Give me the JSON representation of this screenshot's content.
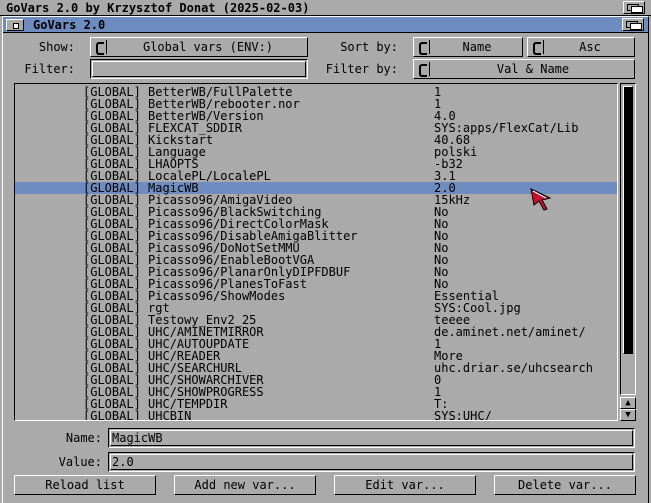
{
  "screen": {
    "title": "GoVars 2.0 by Krzysztof Donat (2025-02-03)"
  },
  "window": {
    "title": "GoVars 2.0"
  },
  "toolbar": {
    "show_label": "Show:",
    "show_value": "Global vars (ENV:)",
    "sortby_label": "Sort by:",
    "sort_field": "Name",
    "sort_order": "Asc",
    "filter_label": "Filter:",
    "filter_value": "",
    "filterby_label": "Filter by:",
    "filterby_value": "Val & Name"
  },
  "list": {
    "selected_index": 8,
    "rows": [
      {
        "scope": "[GLOBAL]",
        "name": "BetterWB/FullPalette",
        "value": "1"
      },
      {
        "scope": "[GLOBAL]",
        "name": "BetterWB/rebooter.nor",
        "value": "1"
      },
      {
        "scope": "[GLOBAL]",
        "name": "BetterWB/Version",
        "value": "4.0"
      },
      {
        "scope": "[GLOBAL]",
        "name": "FLEXCAT_SDDIR",
        "value": "SYS:apps/FlexCat/Lib"
      },
      {
        "scope": "[GLOBAL]",
        "name": "Kickstart",
        "value": "40.68"
      },
      {
        "scope": "[GLOBAL]",
        "name": "Language",
        "value": "polski"
      },
      {
        "scope": "[GLOBAL]",
        "name": "LHAOPTS",
        "value": "-b32"
      },
      {
        "scope": "[GLOBAL]",
        "name": "LocalePL/LocalePL",
        "value": "3.1"
      },
      {
        "scope": "[GLOBAL]",
        "name": "MagicWB",
        "value": "2.0"
      },
      {
        "scope": "[GLOBAL]",
        "name": "Picasso96/AmigaVideo",
        "value": "15kHz"
      },
      {
        "scope": "[GLOBAL]",
        "name": "Picasso96/BlackSwitching",
        "value": "No"
      },
      {
        "scope": "[GLOBAL]",
        "name": "Picasso96/DirectColorMask",
        "value": "No"
      },
      {
        "scope": "[GLOBAL]",
        "name": "Picasso96/DisableAmigaBlitter",
        "value": "No"
      },
      {
        "scope": "[GLOBAL]",
        "name": "Picasso96/DoNotSetMMU",
        "value": "No"
      },
      {
        "scope": "[GLOBAL]",
        "name": "Picasso96/EnableBootVGA",
        "value": "No"
      },
      {
        "scope": "[GLOBAL]",
        "name": "Picasso96/PlanarOnlyDIPFDBUF",
        "value": "No"
      },
      {
        "scope": "[GLOBAL]",
        "name": "Picasso96/PlanesToFast",
        "value": "No"
      },
      {
        "scope": "[GLOBAL]",
        "name": "Picasso96/ShowModes",
        "value": "Essential"
      },
      {
        "scope": "[GLOBAL]",
        "name": "rgt",
        "value": "SYS:Cool.jpg"
      },
      {
        "scope": "[GLOBAL]",
        "name": "Testowy_Env2_25",
        "value": "teeee"
      },
      {
        "scope": "[GLOBAL]",
        "name": "UHC/AMINETMIRROR",
        "value": "de.aminet.net/aminet/"
      },
      {
        "scope": "[GLOBAL]",
        "name": "UHC/AUTOUPDATE",
        "value": "1"
      },
      {
        "scope": "[GLOBAL]",
        "name": "UHC/READER",
        "value": "More"
      },
      {
        "scope": "[GLOBAL]",
        "name": "UHC/SEARCHURL",
        "value": "uhc.driar.se/uhcsearch"
      },
      {
        "scope": "[GLOBAL]",
        "name": "UHC/SHOWARCHIVER",
        "value": "0"
      },
      {
        "scope": "[GLOBAL]",
        "name": "UHC/SHOWPROGRESS",
        "value": "1"
      },
      {
        "scope": "[GLOBAL]",
        "name": "UHC/TEMPDIR",
        "value": "T:"
      },
      {
        "scope": "[GLOBAL]",
        "name": "UHCBIN",
        "value": "SYS:UHC/"
      }
    ]
  },
  "detail": {
    "name_label": "Name:",
    "name_value": "MagicWB",
    "value_label": "Value:",
    "value_value": "2.0"
  },
  "buttons": {
    "reload": "Reload list",
    "add": "Add new var...",
    "edit": "Edit var...",
    "delete": "Delete var..."
  },
  "icons": {
    "up_arrow": "▲",
    "down_arrow": "▼",
    "pointer": "mouse-pointer-icon"
  },
  "colors": {
    "background": "#aaaaaa",
    "selection": "#6f8cc1",
    "window_title": "#6f8cc1",
    "pointer": "#c8102e"
  }
}
